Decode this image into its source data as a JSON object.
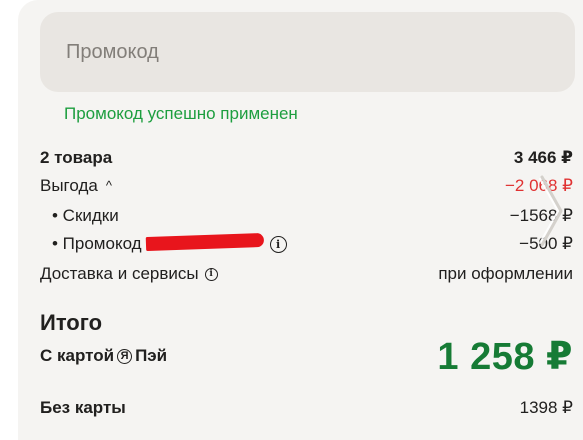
{
  "promo": {
    "placeholder": "Промокод",
    "success_message": "Промокод успешно применен"
  },
  "summary": {
    "items_label": "2 товара",
    "items_total": "3 466 ₽",
    "benefit_label": "Выгода",
    "benefit_chevron": "^",
    "benefit_value": "−2 068 ₽",
    "discounts_label": "• Скидки",
    "discounts_value": "−1568 ₽",
    "promocode_label": "• Промокод",
    "promocode_value": "−500 ₽",
    "delivery_label": "Доставка и сервисы",
    "delivery_value": "при оформлении"
  },
  "total": {
    "title": "Итого",
    "with_card_prefix": "С картой",
    "with_card_logo": "Я",
    "with_card_suffix": "Пэй",
    "with_card_amount": "1 258 ₽",
    "without_card_label": "Без карты",
    "without_card_amount": "1398 ₽"
  },
  "colors": {
    "success_green": "#1d9e3f",
    "price_green": "#167b35",
    "discount_red": "#e03232",
    "redaction": "#e8151c"
  },
  "icons": {
    "info": "info-icon",
    "expand": "chevron-up-icon",
    "next": "chevron-right-icon"
  }
}
